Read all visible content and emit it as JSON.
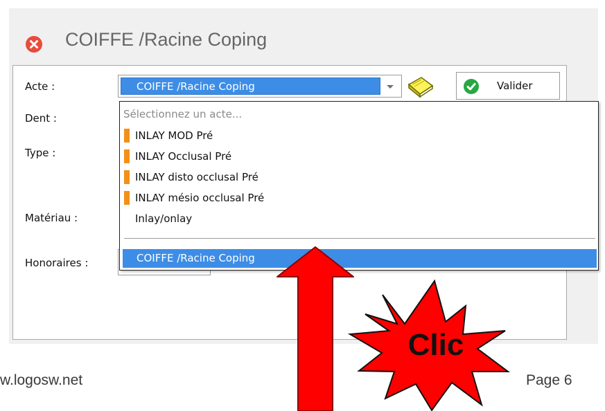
{
  "window": {
    "title": "COIFFE /Racine Coping",
    "icon": "close-circle-icon"
  },
  "form": {
    "acte_label": "Acte :",
    "dent_label": "Dent :",
    "type_label": "Type :",
    "materiau_label": "Matériau :",
    "honoraires_label": "Honoraires :",
    "acte_value": "COIFFE /Racine Coping",
    "book_icon": "book-icon",
    "valider_label": "Valider",
    "valider_icon": "check-circle-icon"
  },
  "dropdown": {
    "placeholder": "Sélectionnez un acte...",
    "items": [
      {
        "label": "INLAY MOD Pré",
        "marker": true
      },
      {
        "label": "INLAY Occlusal Pré",
        "marker": true
      },
      {
        "label": "INLAY disto occlusal Pré",
        "marker": true
      },
      {
        "label": "INLAY mésio occlusal Pré",
        "marker": true
      },
      {
        "label": "Inlay/onlay",
        "marker": false
      }
    ],
    "selected": "COIFFE /Racine Coping"
  },
  "annotation": {
    "starburst_text": "Clic"
  },
  "footer": {
    "left": "w.logosw.net",
    "right": "Page 6"
  },
  "colors": {
    "selection_blue": "#3d8de6",
    "marker_orange": "#f39018",
    "close_red": "#e84c3d",
    "check_green": "#27a844",
    "annotation_red": "#ff0000"
  }
}
